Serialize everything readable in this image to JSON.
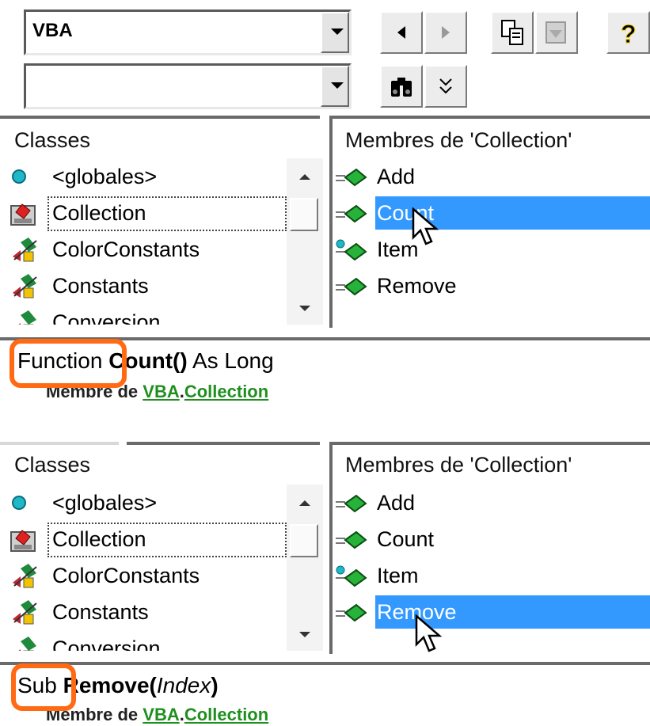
{
  "toolbar": {
    "library_value": "VBA",
    "search_value": "",
    "icons": [
      "back-icon",
      "forward-icon",
      "copy-icon",
      "view-definition-icon",
      "help-icon",
      "search-icon",
      "show-results-icon"
    ]
  },
  "panel_top": {
    "classes_title": "Classes",
    "members_title": "Membres de 'Collection'",
    "classes": [
      {
        "label": "<globales>",
        "icon": "globals-icon"
      },
      {
        "label": "Collection",
        "icon": "class-icon"
      },
      {
        "label": "ColorConstants",
        "icon": "module-icon"
      },
      {
        "label": "Constants",
        "icon": "module-icon"
      },
      {
        "label": "Conversion",
        "icon": "module-icon"
      }
    ],
    "members": [
      {
        "label": "Add",
        "icon": "method-icon"
      },
      {
        "label": "Count",
        "icon": "method-icon",
        "selected": true
      },
      {
        "label": "Item",
        "icon": "default-method-icon"
      },
      {
        "label": "Remove",
        "icon": "method-icon"
      }
    ],
    "signature": {
      "keyword": "Function",
      "name": "Count()",
      "rest": " As Long"
    },
    "member_of": {
      "prefix": "Membre de ",
      "library": "VBA",
      "dot": ".",
      "class": "Collection"
    }
  },
  "panel_bottom": {
    "classes_title": "Classes",
    "members_title": "Membres de 'Collection'",
    "classes": [
      {
        "label": "<globales>",
        "icon": "globals-icon"
      },
      {
        "label": "Collection",
        "icon": "class-icon"
      },
      {
        "label": "ColorConstants",
        "icon": "module-icon"
      },
      {
        "label": "Constants",
        "icon": "module-icon"
      },
      {
        "label": "Conversion",
        "icon": "module-icon"
      }
    ],
    "members": [
      {
        "label": "Add",
        "icon": "method-icon"
      },
      {
        "label": "Count",
        "icon": "method-icon"
      },
      {
        "label": "Item",
        "icon": "default-method-icon"
      },
      {
        "label": "Remove",
        "icon": "method-icon",
        "selected": true
      }
    ],
    "signature": {
      "keyword": "Sub",
      "name": "Remove(",
      "param": "Index",
      "close": ")"
    },
    "member_of": {
      "prefix": "Membre de ",
      "library": "VBA",
      "dot": ".",
      "class": "Collection"
    }
  },
  "colors": {
    "selection": "#3399ff",
    "highlight_ring": "#ff6a13",
    "link": "#1f8f1f"
  }
}
